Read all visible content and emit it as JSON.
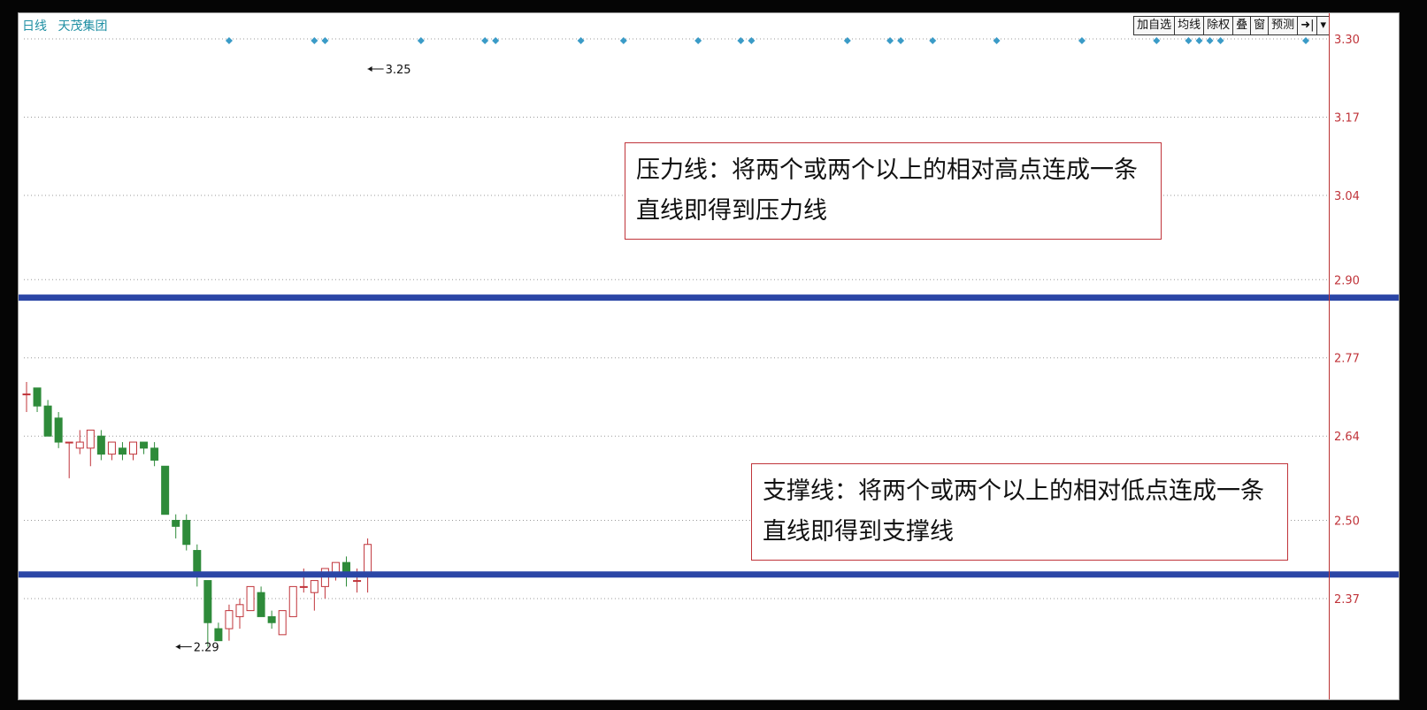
{
  "header": {
    "period": "日线",
    "stock_name": "天茂集团"
  },
  "toolbar": [
    {
      "label": "加自选"
    },
    {
      "label": "均线"
    },
    {
      "label": "除权"
    },
    {
      "label": "叠"
    },
    {
      "label": "窗"
    },
    {
      "label": "预测"
    },
    {
      "label": "➜|"
    },
    {
      "label": "▾"
    }
  ],
  "annotations": {
    "resistance": "压力线：将两个或两个以上的相对高点连成一条直线即得到压力线",
    "support": "支撑线：将两个或两个以上的相对低点连成一条直线即得到支撑线"
  },
  "colors": {
    "up": "#c0343a",
    "down": "#2e8b3a",
    "trendline": "#2b46a6",
    "marker": "#3a9bc7",
    "grid": "#999999",
    "axis_text": "#c0343a"
  },
  "chart_data": {
    "type": "candlestick",
    "y_ticks": [
      "3.30",
      "3.17",
      "3.04",
      "2.90",
      "2.77",
      "2.64",
      "2.50",
      "2.37"
    ],
    "ylim": [
      2.25,
      3.33
    ],
    "grid": "dotted horizontal",
    "annotations": [
      {
        "label": "3.25",
        "candle_index": 32,
        "price": 3.25
      },
      {
        "label": "2.29",
        "candle_index": 14,
        "price": 2.29
      }
    ],
    "resistance_line": 2.87,
    "support_line": 2.41,
    "event_marker_candles": [
      19,
      27,
      28,
      37,
      43,
      44,
      52,
      56,
      63,
      67,
      68,
      77,
      81,
      82,
      85,
      91,
      99,
      106,
      109,
      110,
      111,
      112,
      120
    ],
    "candles": [
      {
        "o": 2.71,
        "h": 2.73,
        "l": 2.68,
        "c": 2.71
      },
      {
        "o": 2.72,
        "h": 2.72,
        "l": 2.68,
        "c": 2.69
      },
      {
        "o": 2.69,
        "h": 2.7,
        "l": 2.64,
        "c": 2.64
      },
      {
        "o": 2.67,
        "h": 2.68,
        "l": 2.62,
        "c": 2.63
      },
      {
        "o": 2.63,
        "h": 2.63,
        "l": 2.57,
        "c": 2.63
      },
      {
        "o": 2.62,
        "h": 2.65,
        "l": 2.61,
        "c": 2.63
      },
      {
        "o": 2.62,
        "h": 2.65,
        "l": 2.59,
        "c": 2.65
      },
      {
        "o": 2.64,
        "h": 2.65,
        "l": 2.6,
        "c": 2.61
      },
      {
        "o": 2.61,
        "h": 2.63,
        "l": 2.6,
        "c": 2.63
      },
      {
        "o": 2.62,
        "h": 2.63,
        "l": 2.6,
        "c": 2.61
      },
      {
        "o": 2.61,
        "h": 2.63,
        "l": 2.6,
        "c": 2.63
      },
      {
        "o": 2.63,
        "h": 2.63,
        "l": 2.61,
        "c": 2.62
      },
      {
        "o": 2.62,
        "h": 2.63,
        "l": 2.59,
        "c": 2.6
      },
      {
        "o": 2.59,
        "h": 2.59,
        "l": 2.51,
        "c": 2.51
      },
      {
        "o": 2.5,
        "h": 2.51,
        "l": 2.47,
        "c": 2.49
      },
      {
        "o": 2.5,
        "h": 2.51,
        "l": 2.45,
        "c": 2.46
      },
      {
        "o": 2.45,
        "h": 2.46,
        "l": 2.39,
        "c": 2.41
      },
      {
        "o": 2.4,
        "h": 2.4,
        "l": 2.29,
        "c": 2.33
      },
      {
        "o": 2.32,
        "h": 2.33,
        "l": 2.3,
        "c": 2.3
      },
      {
        "o": 2.32,
        "h": 2.36,
        "l": 2.3,
        "c": 2.35
      },
      {
        "o": 2.34,
        "h": 2.37,
        "l": 2.32,
        "c": 2.36
      },
      {
        "o": 2.35,
        "h": 2.39,
        "l": 2.35,
        "c": 2.39
      },
      {
        "o": 2.38,
        "h": 2.39,
        "l": 2.34,
        "c": 2.34
      },
      {
        "o": 2.34,
        "h": 2.35,
        "l": 2.32,
        "c": 2.33
      },
      {
        "o": 2.31,
        "h": 2.35,
        "l": 2.31,
        "c": 2.35
      },
      {
        "o": 2.34,
        "h": 2.39,
        "l": 2.34,
        "c": 2.39
      },
      {
        "o": 2.39,
        "h": 2.42,
        "l": 2.38,
        "c": 2.39
      },
      {
        "o": 2.38,
        "h": 2.4,
        "l": 2.35,
        "c": 2.4
      },
      {
        "o": 2.39,
        "h": 2.42,
        "l": 2.37,
        "c": 2.42
      },
      {
        "o": 2.41,
        "h": 2.43,
        "l": 2.4,
        "c": 2.43
      },
      {
        "o": 2.43,
        "h": 2.44,
        "l": 2.39,
        "c": 2.41
      },
      {
        "o": 2.4,
        "h": 2.42,
        "l": 2.38,
        "c": 2.4
      },
      {
        "o": 2.41,
        "h": 2.47,
        "l": 2.38,
        "c": 2.46
      }
    ]
  }
}
